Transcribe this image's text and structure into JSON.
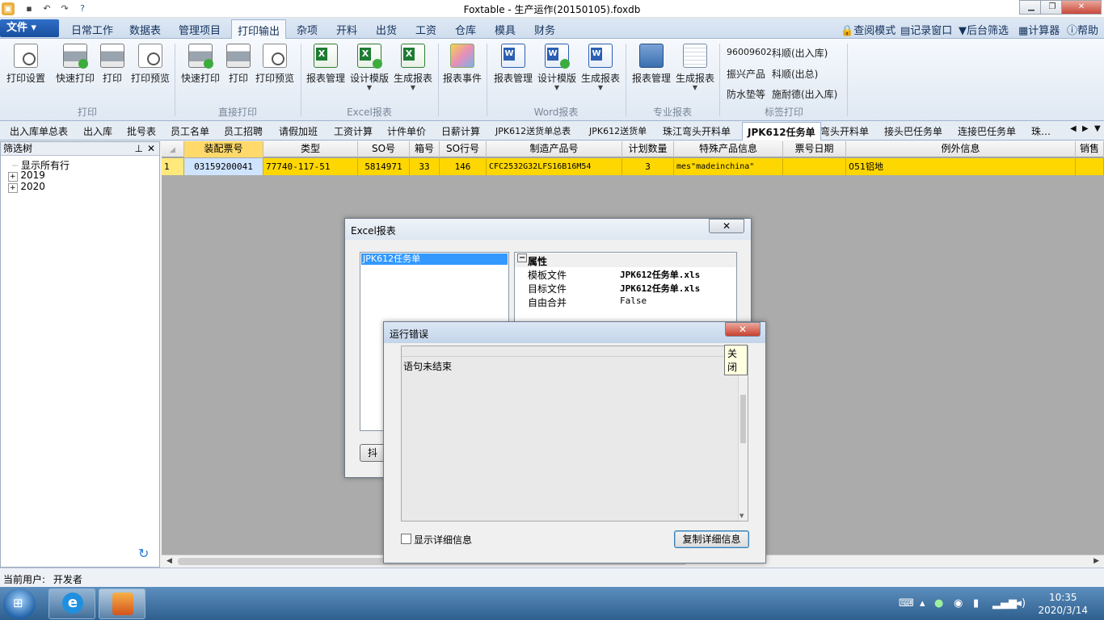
{
  "window": {
    "title": "Foxtable - 生产运作(20150105).foxdb"
  },
  "ribbon_tabs": {
    "file": "文件",
    "tabs": [
      "日常工作",
      "数据表",
      "管理项目",
      "打印输出",
      "杂项",
      "开料",
      "出货",
      "工资",
      "仓库",
      "模具",
      "财务"
    ],
    "active": "打印输出",
    "right": [
      "查阅模式",
      "记录窗口",
      "后台筛选",
      "计算器",
      "帮助"
    ]
  },
  "ribbon": {
    "print_group": {
      "label": "打印",
      "buttons": [
        "打印设置",
        "快速打印",
        "打印",
        "打印预览"
      ]
    },
    "direct_group": {
      "label": "直接打印",
      "buttons": [
        "快速打印",
        "打印",
        "打印预览"
      ]
    },
    "excel_group": {
      "label": "Excel报表",
      "buttons": [
        "报表管理",
        "设计模版",
        "生成报表"
      ]
    },
    "event_button": "报表事件",
    "word_group": {
      "label": "Word报表",
      "buttons": [
        "报表管理",
        "设计模版",
        "生成报表"
      ]
    },
    "special_group": {
      "label": "专业报表",
      "buttons": [
        "报表管理",
        "生成报表"
      ]
    },
    "label_group": {
      "label": "标签打印",
      "items": [
        "96009602",
        "科顺(出入库)",
        "振兴产品",
        "科顺(出总)",
        "防水垫等",
        "施耐德(出入库)"
      ]
    }
  },
  "doc_tabs": [
    "出入库单总表",
    "出入库",
    "批号表",
    "员工名单",
    "员工招聘",
    "请假加班",
    "工资计算",
    "计件单价",
    "日薪计算",
    "JPK612送货单总表",
    "JPK612送货单",
    "珠江弯头开料单",
    "JPK612任务单",
    "弯头开料单",
    "接头巴任务单",
    "连接巴任务单",
    "珠…"
  ],
  "active_doc_tab": "JPK612任务单",
  "left_panel": {
    "title": "筛选树",
    "items": [
      "显示所有行",
      "2019",
      "2020"
    ]
  },
  "grid": {
    "headers": [
      "装配票号",
      "类型",
      "SO号",
      "箱号",
      "SO行号",
      "制造产品号",
      "计划数量",
      "特殊产品信息",
      "票号日期",
      "例外信息",
      "销售"
    ],
    "row": {
      "index": "1",
      "cells": [
        "03159200041",
        "77740-117-51",
        "5814971",
        "33",
        "146",
        "CFC2532G32LFS16B16M54",
        "3",
        "mes\"madeinchina\"",
        "",
        "051铝地",
        ""
      ]
    }
  },
  "excel_dialog": {
    "title": "Excel报表",
    "list_item": "JPK612任务单",
    "prop_header": "属性",
    "props": [
      {
        "name": "模板文件",
        "value": "JPK612任务单.xls"
      },
      {
        "name": "目标文件",
        "value": "JPK612任务单.xls"
      },
      {
        "name": "自由合并",
        "value": "False"
      }
    ],
    "partial_button": "抖"
  },
  "error_dialog": {
    "title": "运行错误",
    "message": "语句未结束",
    "tooltip": "关闭",
    "checkbox_label": "显示详细信息",
    "copy_button": "复制详细信息"
  },
  "status": {
    "user_label": "当前用户:",
    "user": "开发者"
  },
  "clock": {
    "time": "10:35",
    "date": "2020/3/14"
  }
}
